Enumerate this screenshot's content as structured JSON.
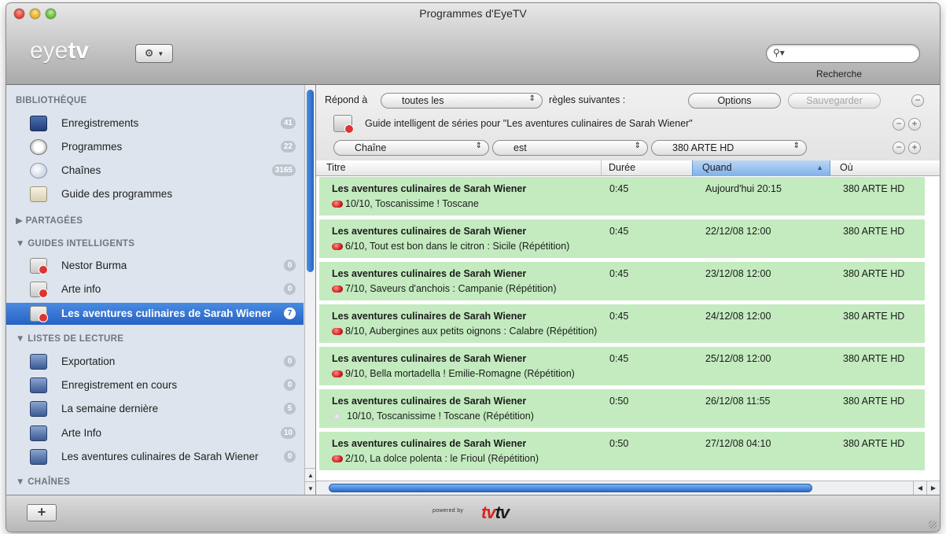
{
  "window": {
    "title": "Programmes d'EyeTV"
  },
  "toolbar": {
    "logo_light": "eye",
    "logo_bold": "tv",
    "gear_icon": "gear-icon",
    "search": {
      "value": "",
      "placeholder": "",
      "label": "Recherche"
    }
  },
  "sidebar": {
    "sections": {
      "bibliotheque": "BIBLIOTHÈQUE",
      "partagees": "PARTAGÉES",
      "guides": "GUIDES INTELLIGENTS",
      "listes": "LISTES DE LECTURE",
      "chaines": "CHAÎNES"
    },
    "library": [
      {
        "label": "Enregistrements",
        "badge": "41",
        "icon": "recordings-icon"
      },
      {
        "label": "Programmes",
        "badge": "22",
        "icon": "programs-clock-icon"
      },
      {
        "label": "Chaînes",
        "badge": "3165",
        "icon": "channels-dish-icon"
      },
      {
        "label": "Guide des programmes",
        "badge": "",
        "icon": "program-guide-icon"
      }
    ],
    "guides": [
      {
        "label": "Nestor Burma",
        "badge": "0"
      },
      {
        "label": "Arte info",
        "badge": "0"
      },
      {
        "label": "Les aventures culinaires de Sarah Wiener",
        "badge": "7",
        "selected": true
      }
    ],
    "playlists": [
      {
        "label": "Exportation",
        "badge": "0"
      },
      {
        "label": "Enregistrement en cours",
        "badge": "0"
      },
      {
        "label": "La semaine dernière",
        "badge": "5"
      },
      {
        "label": "Arte Info",
        "badge": "10"
      },
      {
        "label": "Les aventures culinaires de Sarah Wiener",
        "badge": "0"
      }
    ]
  },
  "rules": {
    "prefix": "Répond à",
    "match_value": "toutes les",
    "suffix": "règles suivantes :",
    "options_label": "Options",
    "save_label": "Sauvegarder",
    "guide_text": "Guide intelligent de séries pour \"Les aventures culinaires de Sarah Wiener\"",
    "condition": {
      "field": "Chaîne",
      "operator": "est",
      "value": "380 ARTE HD"
    },
    "minus": "−",
    "plus": "+"
  },
  "table": {
    "columns": {
      "titre": "Titre",
      "duree": "Durée",
      "quand": "Quand",
      "ou": "Où"
    },
    "sort_indicator": "▲",
    "rows": [
      {
        "title": "Les aventures culinaires de Sarah Wiener",
        "subtitle": "10/10, Toscanissime ! Toscane",
        "duration": "0:45",
        "when": "Aujourd'hui 20:15",
        "where": "380 ARTE HD",
        "recording": true
      },
      {
        "title": "Les aventures culinaires de Sarah Wiener",
        "subtitle": "6/10, Tout est bon dans le citron : Sicile (Répétition)",
        "duration": "0:45",
        "when": "22/12/08 12:00",
        "where": "380 ARTE HD",
        "recording": true
      },
      {
        "title": "Les aventures culinaires de Sarah Wiener",
        "subtitle": "7/10, Saveurs d'anchois : Campanie (Répétition)",
        "duration": "0:45",
        "when": "23/12/08 12:00",
        "where": "380 ARTE HD",
        "recording": true
      },
      {
        "title": "Les aventures culinaires de Sarah Wiener",
        "subtitle": "8/10, Aubergines aux petits oignons : Calabre (Répétition)",
        "duration": "0:45",
        "when": "24/12/08 12:00",
        "where": "380 ARTE HD",
        "recording": true
      },
      {
        "title": "Les aventures culinaires de Sarah Wiener",
        "subtitle": "9/10, Bella mortadella ! Emilie-Romagne (Répétition)",
        "duration": "0:45",
        "when": "25/12/08 12:00",
        "where": "380 ARTE HD",
        "recording": true
      },
      {
        "title": "Les aventures culinaires de Sarah Wiener",
        "subtitle": "10/10, Toscanissime ! Toscane (Répétition)",
        "duration": "0:50",
        "when": "26/12/08 11:55",
        "where": "380 ARTE HD",
        "recording": false
      },
      {
        "title": "Les aventures culinaires de Sarah Wiener",
        "subtitle": "2/10, La dolce polenta : le Frioul (Répétition)",
        "duration": "0:50",
        "when": "27/12/08 04:10",
        "where": "380 ARTE HD",
        "recording": true
      }
    ]
  },
  "footer": {
    "add_label": "+",
    "powered_by": "powered by",
    "brand_tv1": "tv",
    "brand_tv2": "tv"
  },
  "colors": {
    "row_green": "#c3ebbf",
    "selection_blue": "#2a64c4",
    "record_red": "#d11f1f"
  }
}
